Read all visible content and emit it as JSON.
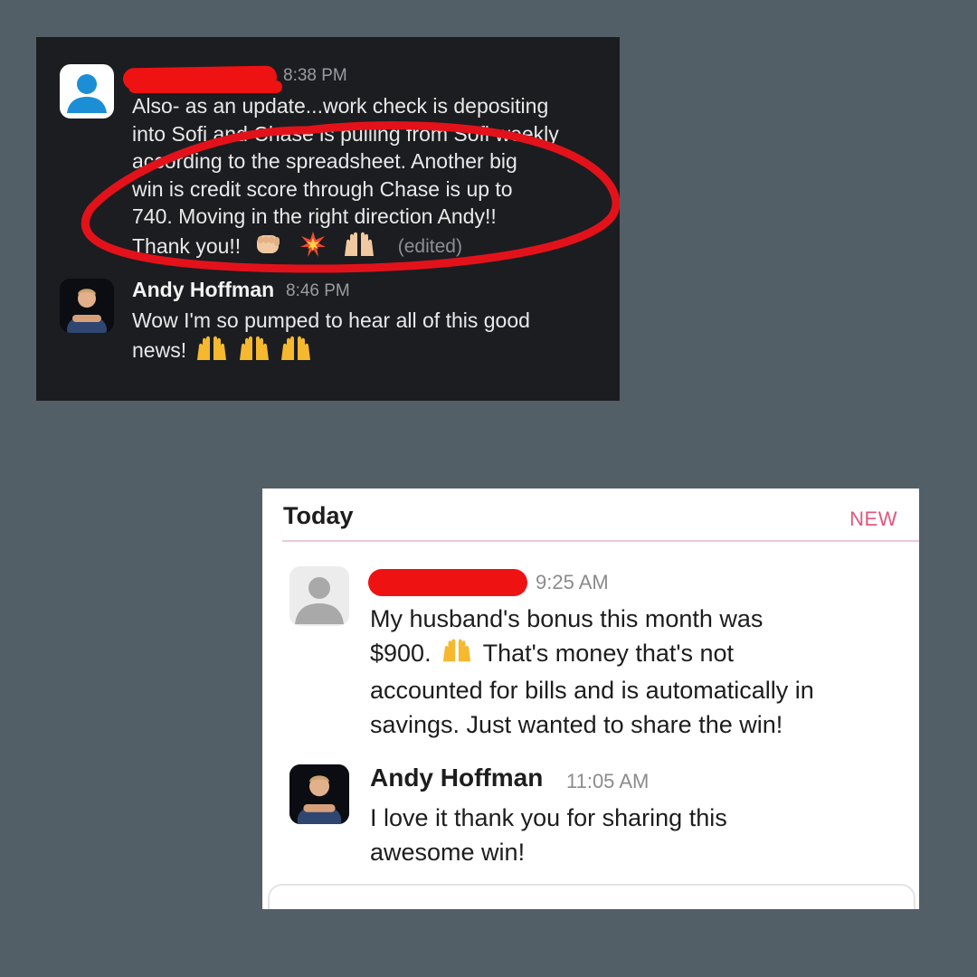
{
  "dark_chat": {
    "messages": [
      {
        "sender": "",
        "time": "8:38 PM",
        "lines": [
          "Also- as an update...work check is depositing",
          "into Sofi and Chase is pulling from Sofi weekly",
          "according to the spreadsheet.  Another big",
          "win is credit score through Chase is up to",
          "740. Moving in the right direction Andy!!",
          "Thank you!!"
        ],
        "edited_label": "(edited)",
        "emojis": [
          "fist-bump-emoji",
          "collision-emoji",
          "raised-hands-emoji"
        ]
      },
      {
        "sender": "Andy Hoffman",
        "time": "8:46 PM",
        "lines": [
          "Wow I'm so pumped to hear all of this good",
          "news!"
        ],
        "emojis": [
          "raised-hands-emoji",
          "raised-hands-emoji",
          "raised-hands-emoji"
        ]
      }
    ]
  },
  "light_chat": {
    "header": "Today",
    "new_label": "NEW",
    "messages": [
      {
        "sender": "",
        "time": "9:25 AM",
        "lines": [
          "My husband's bonus this month was",
          "$900.",
          "That's money that's not",
          "accounted for bills and is automatically in",
          "savings. Just wanted to share the win!"
        ],
        "emojis": [
          "raised-hands-emoji"
        ]
      },
      {
        "sender": "Andy Hoffman",
        "time": "11:05 AM",
        "lines": [
          "I love it thank you for sharing this",
          "awesome win!"
        ]
      }
    ]
  },
  "colors": {
    "background": "#535f66",
    "dark_card": "#1c1d21",
    "highlight_circle": "#e3121a",
    "redaction": "#ee1212",
    "new_label": "#e0567f"
  }
}
